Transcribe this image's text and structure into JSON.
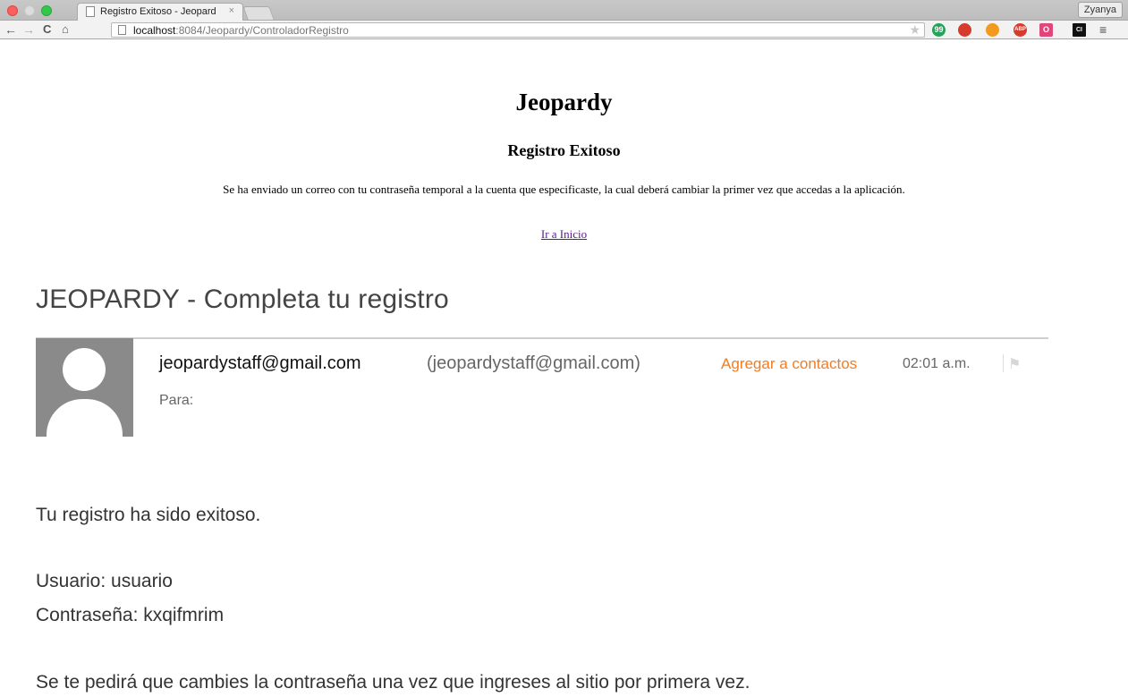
{
  "browser": {
    "tab_title": "Registro Exitoso - Jeopard",
    "tab_close": "×",
    "profile_name": "Zyanya",
    "url_host": "localhost",
    "url_path": ":8084/Jeopardy/ControladorRegistro",
    "nav": {
      "back": "←",
      "forward": "→",
      "reload": "C",
      "home": "⌂"
    },
    "bookmark_star": "★",
    "menu_icon": "≡",
    "extensions": [
      {
        "name": "hangouts-icon",
        "glyph": "99"
      },
      {
        "name": "stop-icon",
        "glyph": ""
      },
      {
        "name": "fox-icon",
        "glyph": ""
      },
      {
        "name": "adblock-icon",
        "glyph": "ABP"
      },
      {
        "name": "opera-icon",
        "glyph": "O"
      },
      {
        "name": "ci-icon",
        "glyph": "CI"
      }
    ]
  },
  "page": {
    "heading": "Jeopardy",
    "subheading": "Registro Exitoso",
    "message": "Se ha enviado un correo con tu contraseña temporal a la cuenta que especificaste, la cual deberá cambiar la primer vez que accedas a la aplicación.",
    "home_link": "Ir a Inicio"
  },
  "email": {
    "subject": "JEOPARDY - Completa tu registro",
    "sender_name": "jeopardystaff@gmail.com",
    "sender_address": "(jeopardystaff@gmail.com)",
    "add_contact": "Agregar a contactos",
    "time": "02:01 a.m.",
    "to_label": "Para:",
    "body": {
      "line1": "Tu registro ha sido exitoso.",
      "user": "Usuario: usuario",
      "password": "Contraseña: kxqifmrim",
      "notice": "Se te pedirá que cambies la contraseña una vez que ingreses al sitio por primera vez."
    }
  },
  "colors": {
    "link": "#551a8b",
    "accent_orange": "#f47c20"
  }
}
